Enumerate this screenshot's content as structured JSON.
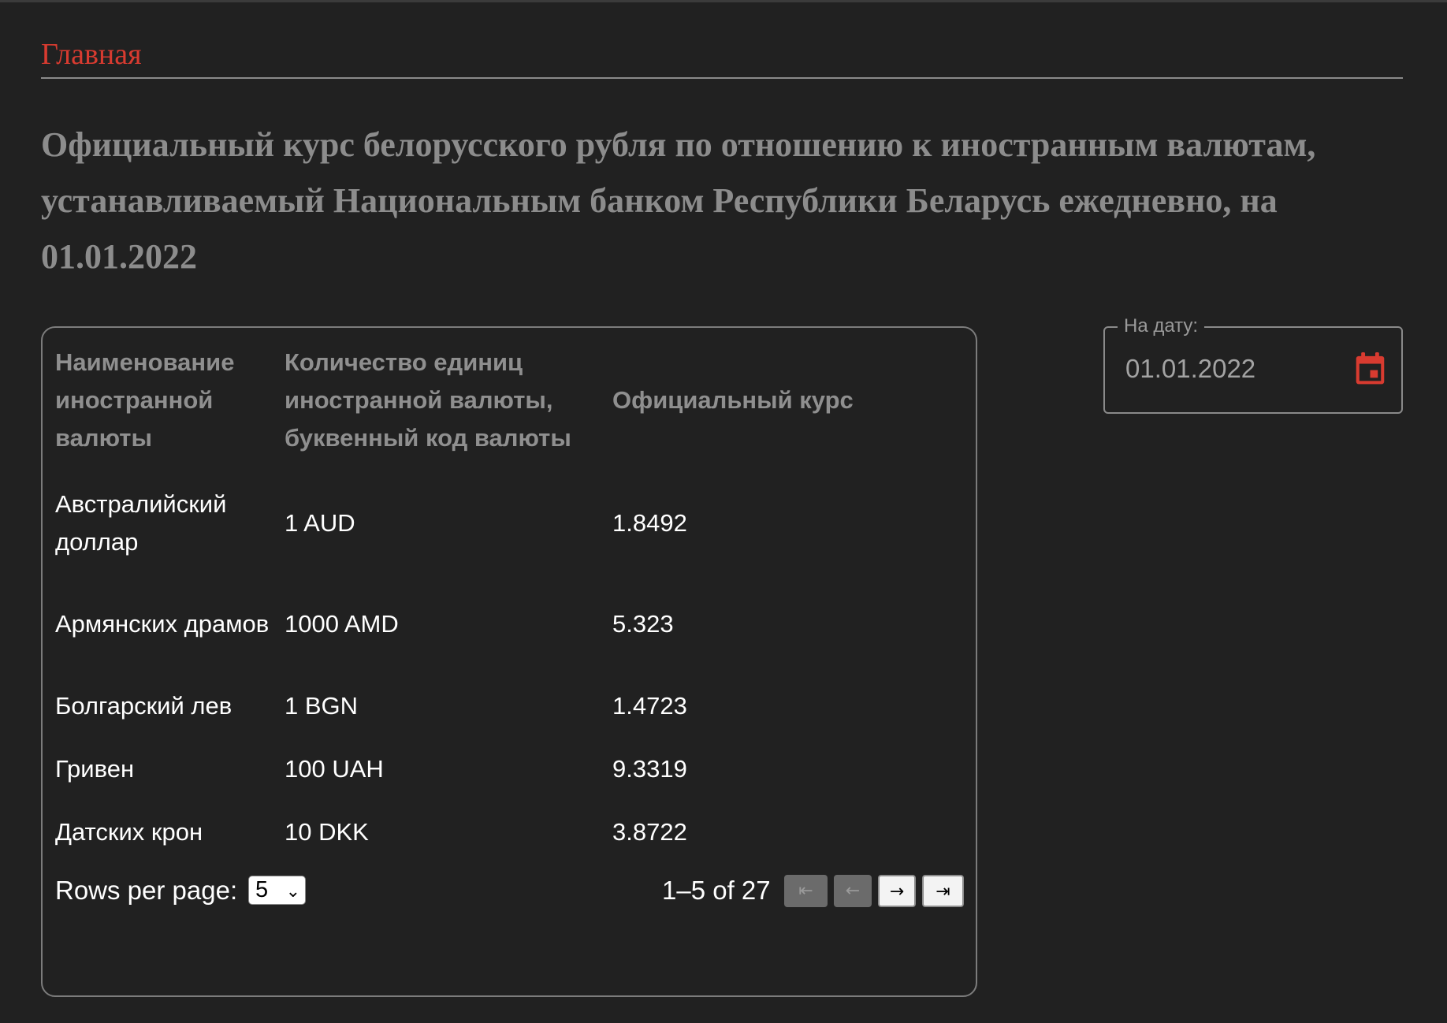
{
  "nav": {
    "home_link": "Главная"
  },
  "page": {
    "title": "Официальный курс белорусского рубля по отношению к иностранным валютам, устанавливаемый Национальным банком Республики Беларусь ежедневно, на 01.01.2022"
  },
  "table": {
    "headers": [
      "Наименование иностранной валюты",
      "Количество единиц иностранной валюты, буквенный код валюты",
      "Официальный курс"
    ],
    "rows": [
      {
        "name": "Австралийский доллар",
        "units": "1 AUD",
        "rate": "1.8492"
      },
      {
        "name": "Армянских драмов",
        "units": "1000 AMD",
        "rate": "5.323"
      },
      {
        "name": "Болгарский лев",
        "units": "1 BGN",
        "rate": "1.4723"
      },
      {
        "name": "Гривен",
        "units": "100 UAH",
        "rate": "9.3319"
      },
      {
        "name": "Датских крон",
        "units": "10 DKK",
        "rate": "3.8722"
      }
    ]
  },
  "pagination": {
    "rows_per_page_label": "Rows per page:",
    "rows_per_page_value": "5",
    "range_text": "1–5 of 27",
    "first_icon": "first-page-icon",
    "prev_icon": "previous-page-icon",
    "next_icon": "next-page-icon",
    "last_icon": "last-page-icon"
  },
  "date_picker": {
    "label": "На дату:",
    "value": "01.01.2022",
    "icon": "calendar-icon"
  },
  "colors": {
    "background": "#212121",
    "accent": "#d83b30",
    "muted_text": "#8c8c8c",
    "border": "#7c7c7c"
  }
}
